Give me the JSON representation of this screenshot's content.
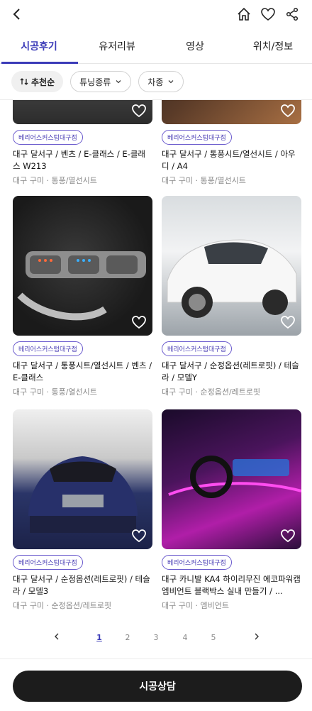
{
  "header": {
    "back_icon": "chevron-left-icon",
    "actions": [
      "home-icon",
      "heart-icon",
      "share-icon"
    ]
  },
  "tabs": [
    {
      "label": "시공후기",
      "active": true
    },
    {
      "label": "유저리뷰",
      "active": false
    },
    {
      "label": "영상",
      "active": false
    },
    {
      "label": "위치/정보",
      "active": false
    }
  ],
  "filters": {
    "sort_label": "추천순",
    "tuning_label": "튜닝종류",
    "car_label": "차종"
  },
  "cards": [
    {
      "badge": "베리어스커스텀대구점",
      "title": "대구 달서구 / 벤츠 / E-클래스 / E-클래스 W213",
      "meta": "대구 구미 · 통풍/열선시트"
    },
    {
      "badge": "베리어스커스텀대구점",
      "title": "대구 달서구 / 통풍시트/열선시트 / 아우디 / A4",
      "meta": "대구 구미 · 통풍/열선시트"
    },
    {
      "badge": "베리어스커스텀대구점",
      "title": "대구 달서구 / 통풍시트/열선시트 / 벤츠 / E-클래스",
      "meta": "대구 구미 · 통풍/열선시트"
    },
    {
      "badge": "베리어스커스텀대구점",
      "title": "대구 달서구 / 순정옵션(레트로핏) / 테슬라 / 모델Y",
      "meta": "대구 구미 · 순정옵션/레트로핏"
    },
    {
      "badge": "베리어스커스텀대구점",
      "title": "대구 달서구 / 순정옵션(레트로핏) / 테슬라 / 모델3",
      "meta": "대구 구미 · 순정옵션/레트로핏"
    },
    {
      "badge": "베리어스커스텀대구점",
      "title": "대구 카니발 KA4 하이리무진 에코파워캡 엠비언트 블랙박스 실내 만들기 / ...",
      "meta": "대구 구미 · 엠비언트"
    }
  ],
  "pagination": {
    "prev_icon": "chevron-left-icon",
    "pages": [
      "1",
      "2",
      "3",
      "4",
      "5"
    ],
    "current": "1",
    "next_icon": "chevron-right-icon"
  },
  "cta": {
    "label": "시공상담"
  },
  "colors": {
    "accent": "#3b3bb8",
    "cta_bg": "#1c1c1c"
  }
}
